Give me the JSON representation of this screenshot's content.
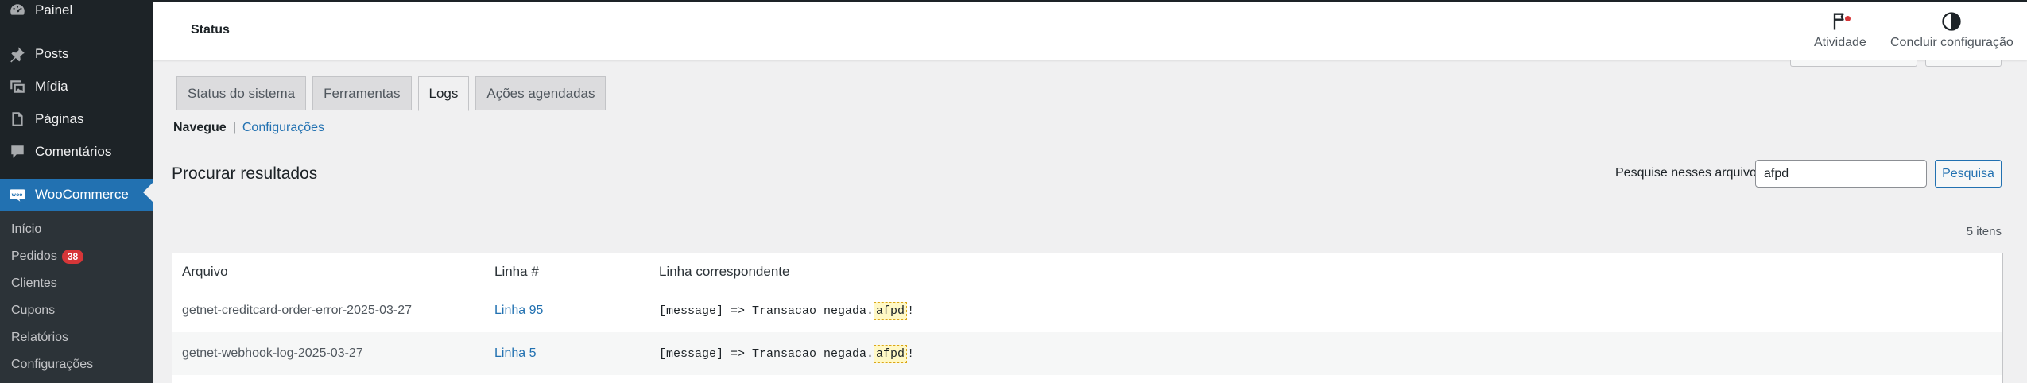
{
  "sidebar": {
    "items": [
      {
        "label": "Painel",
        "icon": "dashboard-icon"
      },
      {
        "label": "Posts",
        "icon": "pin-icon"
      },
      {
        "label": "Mídia",
        "icon": "media-icon"
      },
      {
        "label": "Páginas",
        "icon": "pages-icon"
      },
      {
        "label": "Comentários",
        "icon": "comments-icon"
      },
      {
        "label": "WooCommerce",
        "icon": "woocommerce-icon"
      }
    ],
    "submenu": [
      {
        "label": "Início"
      },
      {
        "label": "Pedidos",
        "badge": "38"
      },
      {
        "label": "Clientes"
      },
      {
        "label": "Cupons"
      },
      {
        "label": "Relatórios"
      },
      {
        "label": "Configurações"
      }
    ]
  },
  "header": {
    "title": "Status",
    "activity_label": "Atividade",
    "finish_label": "Concluir configuração"
  },
  "tabs": [
    {
      "label": "Status do sistema",
      "active": false
    },
    {
      "label": "Ferramentas",
      "active": false
    },
    {
      "label": "Logs",
      "active": true
    },
    {
      "label": "Ações agendadas",
      "active": false
    }
  ],
  "subnav": {
    "current": "Navegue",
    "separator": "|",
    "link": "Configurações"
  },
  "search": {
    "title": "Procurar resultados",
    "label": "Pesquise nesses arquivos",
    "value": "afpd",
    "button": "Pesquisa"
  },
  "results_count": "5 itens",
  "table": {
    "headers": [
      "Arquivo",
      "Linha #",
      "Linha correspondente"
    ],
    "rows": [
      {
        "file": "getnet-creditcard-order-error-2025-03-27",
        "line": "Linha 95",
        "match_prefix": "[message] => Transacao negada.",
        "match_highlight": "afpd",
        "match_suffix": "!"
      },
      {
        "file": "getnet-webhook-log-2025-03-27",
        "line": "Linha 5",
        "match_prefix": "[message] => Transacao negada.",
        "match_highlight": "afpd",
        "match_suffix": "!"
      }
    ]
  },
  "colors": {
    "sidebar_bg": "#1d2327",
    "accent": "#2271b1",
    "badge": "#d63638",
    "highlight": "#fff8c5"
  }
}
